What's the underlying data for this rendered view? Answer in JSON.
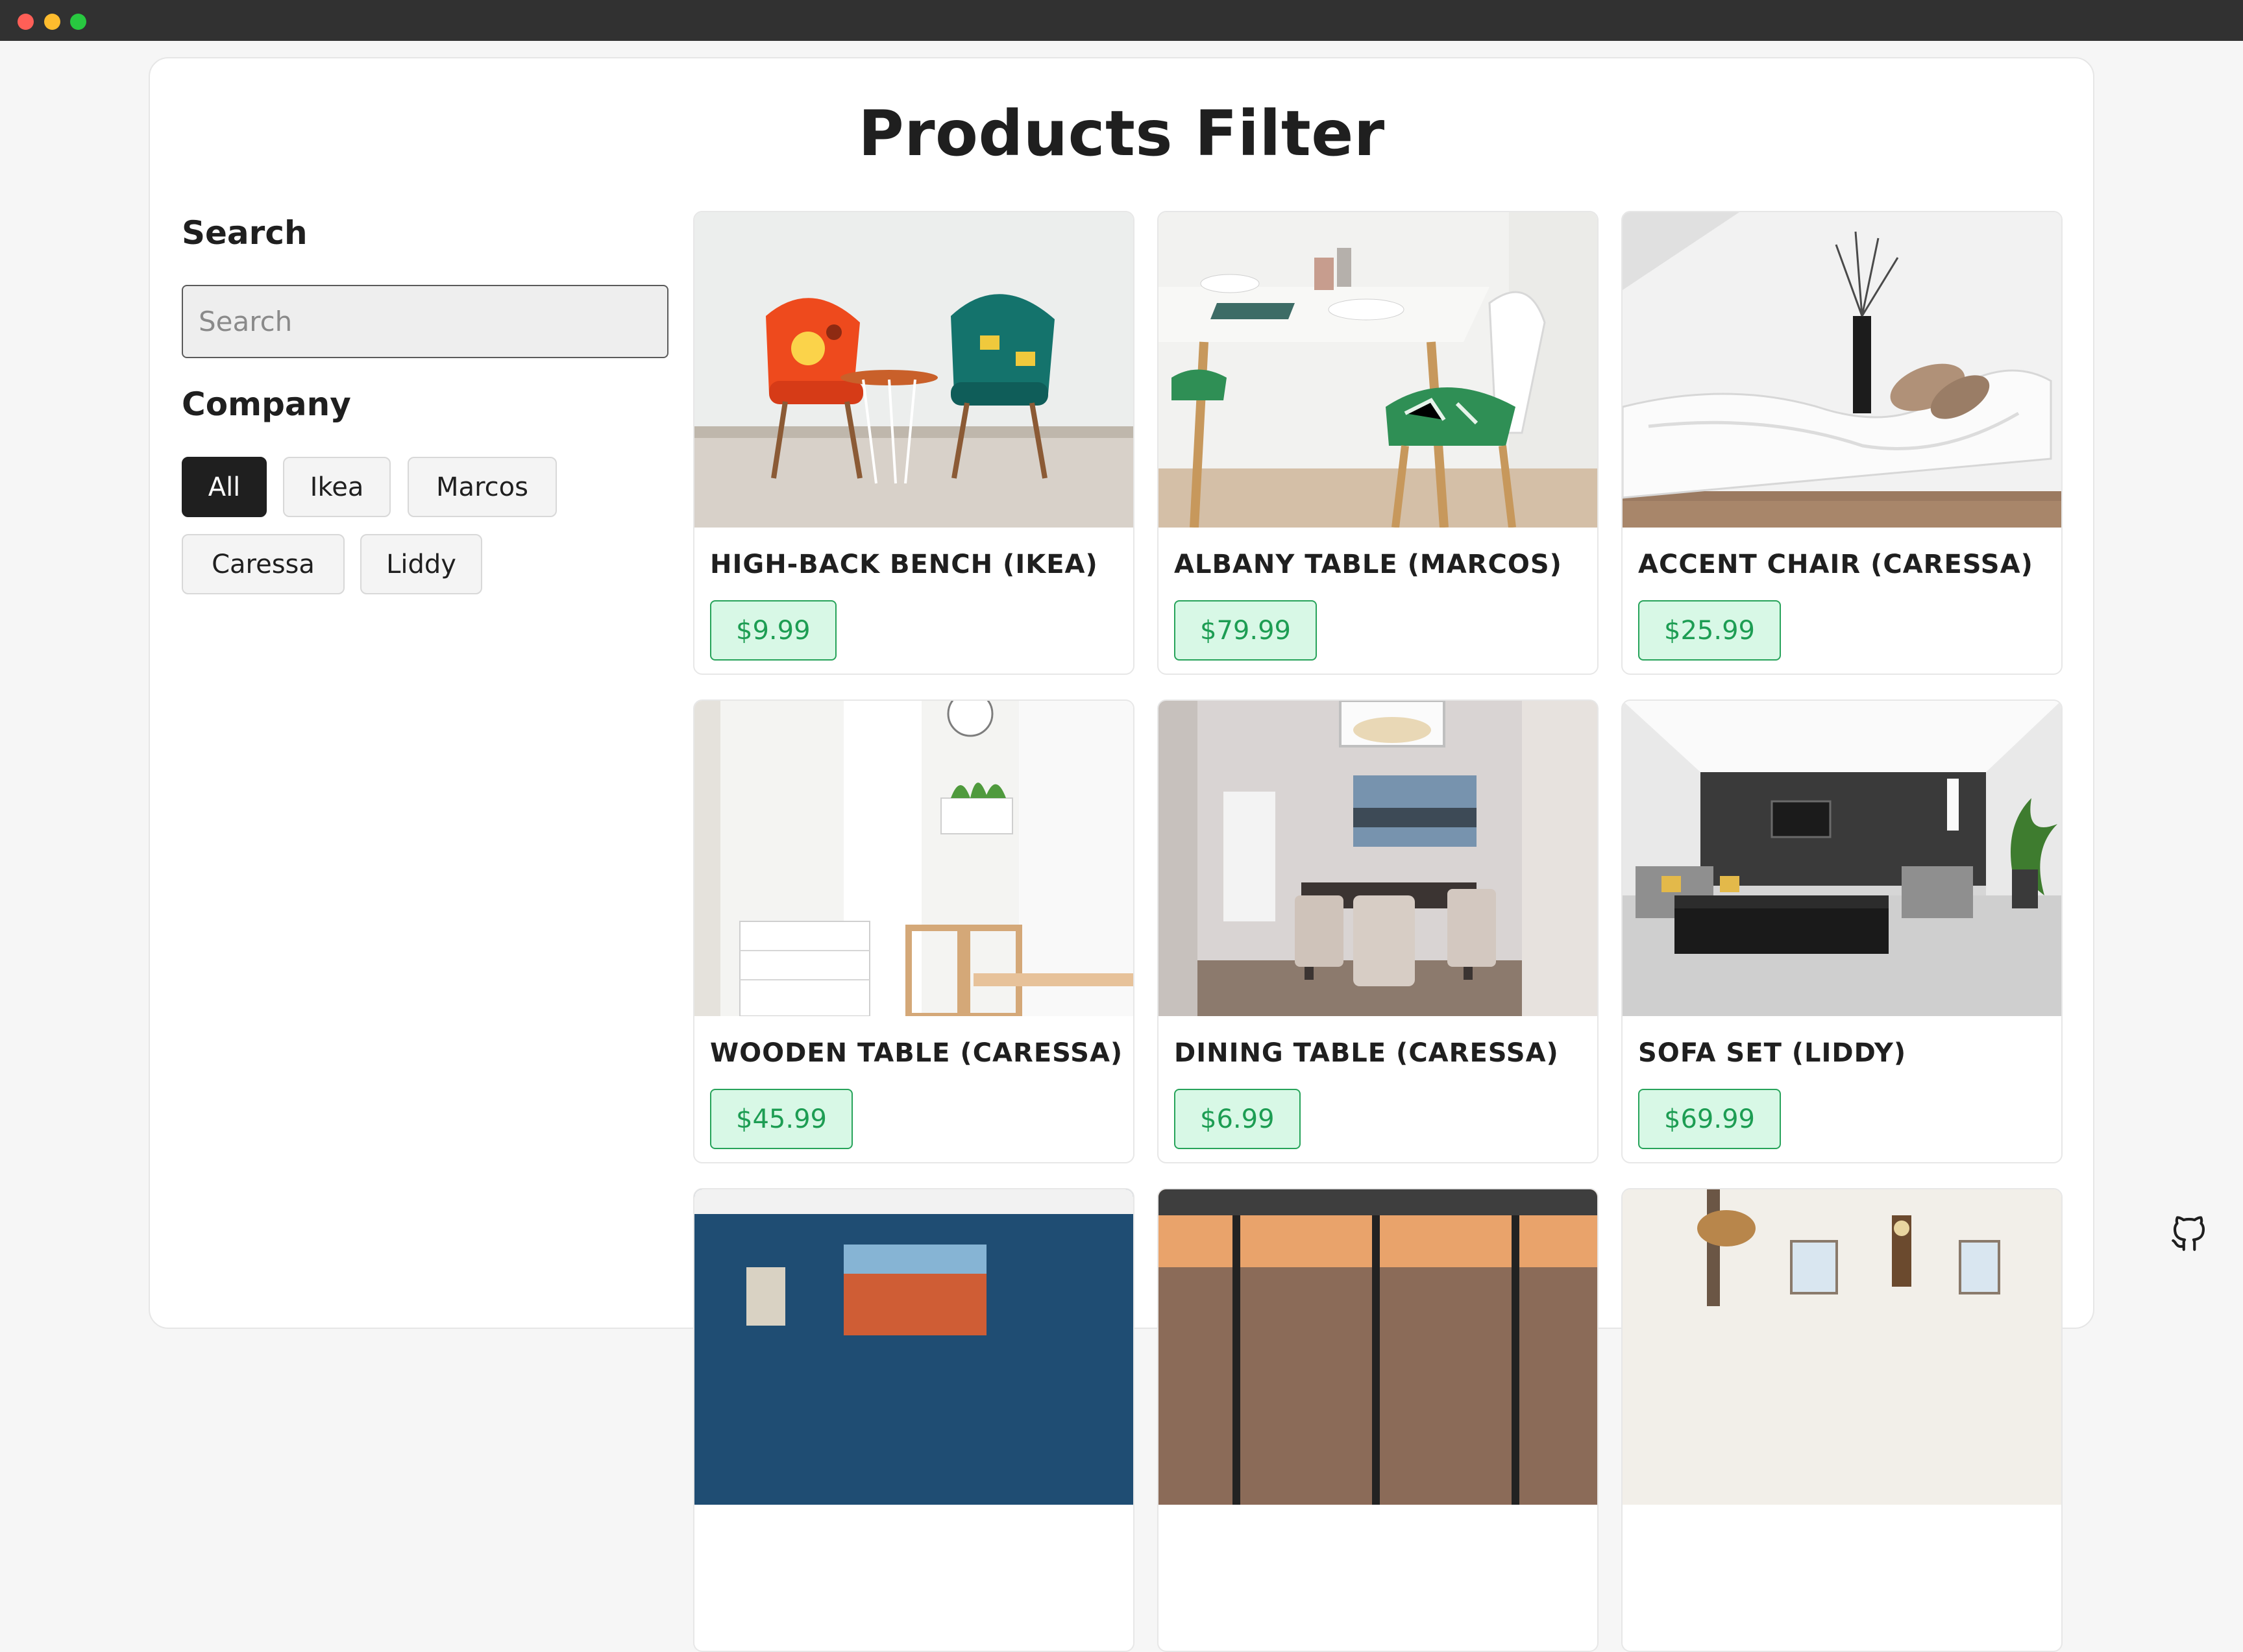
{
  "window": {
    "colors": {
      "titlebar": "#313131",
      "close": "#ff5f57",
      "minimize": "#febc2e",
      "maximize": "#28c840"
    }
  },
  "page": {
    "title": "Products Filter"
  },
  "sidebar": {
    "search_label": "Search",
    "search_placeholder": "Search",
    "search_value": "",
    "company_label": "Company",
    "companies": [
      {
        "label": "All",
        "active": true
      },
      {
        "label": "Ikea",
        "active": false
      },
      {
        "label": "Marcos",
        "active": false
      },
      {
        "label": "Caressa",
        "active": false
      },
      {
        "label": "Liddy",
        "active": false
      }
    ]
  },
  "products": [
    {
      "name": "HIGH-BACK BENCH (IKEA)",
      "price": "$9.99",
      "image": "two colorful patterned chairs with side table"
    },
    {
      "name": "ALBANY TABLE (MARCOS)",
      "price": "$79.99",
      "image": "dining table with bowls and wooden chairs"
    },
    {
      "name": "ACCENT CHAIR (CARESSA)",
      "price": "$25.99",
      "image": "white lounge chaise with cushions and vase"
    },
    {
      "name": "WOODEN TABLE (CARESSA)",
      "price": "$45.99",
      "image": "white room with dresser, clock and wooden chairs"
    },
    {
      "name": "DINING TABLE (CARESSA)",
      "price": "$6.99",
      "image": "dining room with dark table and upholstered chairs"
    },
    {
      "name": "SOFA SET (LIDDY)",
      "price": "$69.99",
      "image": "modern living room with black sofa set"
    },
    {
      "name": "",
      "price": "",
      "image": "blue wall with framed painting"
    },
    {
      "name": "",
      "price": "",
      "image": "window view with sunset sky"
    },
    {
      "name": "",
      "price": "",
      "image": "bright room with lamp and clock"
    }
  ],
  "footer": {
    "icon": "github-icon"
  },
  "colors": {
    "accent": "#1f1f1f",
    "price_text": "#1d9d53",
    "price_bg": "#d8f8e6",
    "price_border": "#27a35a"
  }
}
